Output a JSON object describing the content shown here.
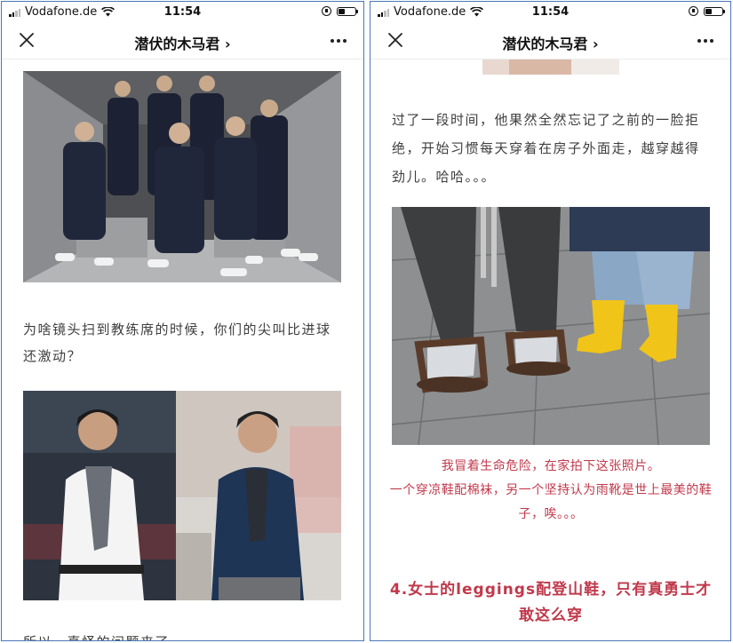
{
  "status_bar": {
    "carrier": "Vodafone.de",
    "time": "11:54"
  },
  "nav": {
    "title": "潜伏的木马君",
    "chevron": "›"
  },
  "left": {
    "caption": "为啥镜头扫到教练席的时候，你们的尖叫比进球还激动？",
    "partial_text": "所以，真怪的问题来了"
  },
  "right": {
    "paragraph": "过了一段时间，他果然全然忘记了之前的一脸拒绝，开始习惯每天穿着在房子外面走，越穿越得劲儿。哈哈。。。",
    "photo_caption_line1": "我冒着生命危险，在家拍下这张照片。",
    "photo_caption_line2": "一个穿凉鞋配棉袜，另一个坚持认为雨靴是世上最美的鞋子，唉。。。",
    "heading": "4.女士的leggings配登山鞋，只有真勇士才敢这么穿"
  },
  "icons": {
    "signal": "signal-icon",
    "wifi": "wifi-icon",
    "rotation_lock": "rotation-lock-icon",
    "battery": "battery-icon",
    "close": "close-icon",
    "more": "more-icon"
  },
  "colors": {
    "frame_border": "#4a77b8",
    "accent_red": "#c0394b",
    "body_text": "#3e3e3e"
  }
}
